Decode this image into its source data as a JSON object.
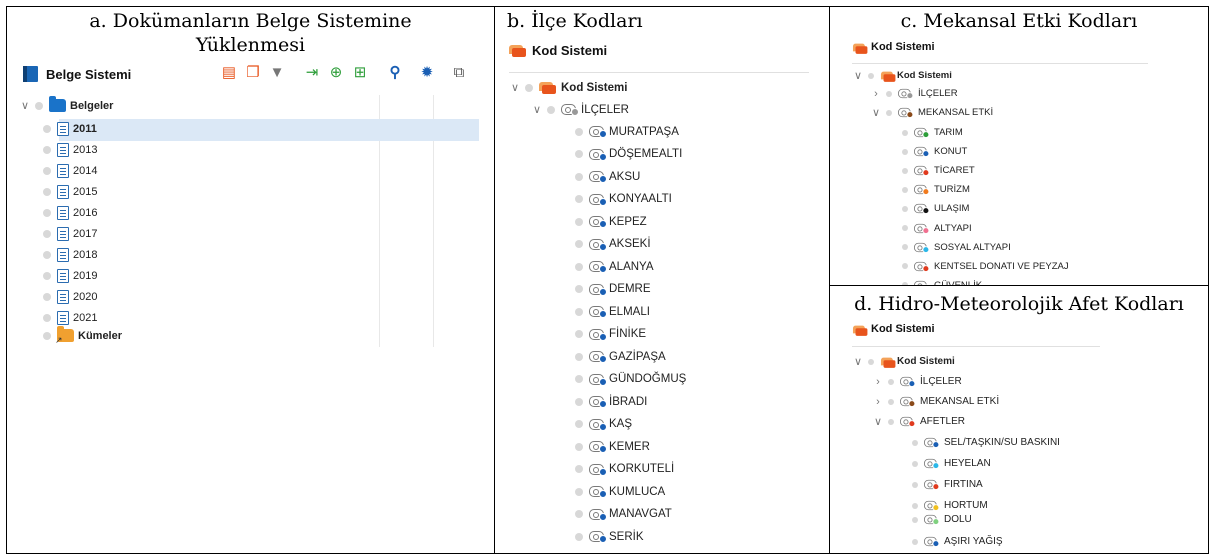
{
  "panel_a": {
    "title_line1": "a. Dokümanların Belge Sistemine",
    "title_line2": "Yüklenmesi",
    "header": "Belge Sistemi",
    "toolbar_icons": [
      "clipboard-icon",
      "copy-icon",
      "filter-icon",
      "import-icon",
      "add-document-icon",
      "add-folder-icon",
      "search-icon",
      "gear-icon",
      "window-icon"
    ],
    "tree": {
      "root_label": "Belgeler",
      "years": [
        "2011",
        "2013",
        "2014",
        "2015",
        "2016",
        "2017",
        "2018",
        "2019",
        "2020",
        "2021"
      ],
      "selected": "2011",
      "clusters_label": "Kümeler"
    }
  },
  "panel_b": {
    "title": "b. İlçe Kodları",
    "header": "Kod Sistemi",
    "root_label": "Kod Sistemi",
    "group_label": "İLÇELER",
    "dot_color": "#1a5fb4",
    "districts": [
      "MURATPAŞA",
      "DÖŞEMEALTI",
      "AKSU",
      "KONYAALTI",
      "KEPEZ",
      "AKSEKİ",
      "ALANYA",
      "DEMRE",
      "ELMALI",
      "FİNİKE",
      "GAZİPAŞA",
      "GÜNDOĞMUŞ",
      "İBRADI",
      "KAŞ",
      "KEMER",
      "KORKUTELİ",
      "KUMLUCA",
      "MANAVGAT",
      "SERİK"
    ]
  },
  "panel_c": {
    "title": "c. Mekansal Etki Kodları",
    "header": "Kod Sistemi",
    "root_label": "Kod Sistemi",
    "group1_label": "İLÇELER",
    "group2_label": "MEKANSAL ETKİ",
    "codes": [
      {
        "label": "TARIM",
        "color": "#2e9e3a"
      },
      {
        "label": "KONUT",
        "color": "#1a5fb4"
      },
      {
        "label": "TİCARET",
        "color": "#e03a1e"
      },
      {
        "label": "TURİZM",
        "color": "#f07a1e"
      },
      {
        "label": "ULAŞIM",
        "color": "#111111"
      },
      {
        "label": "ALTYAPI",
        "color": "#f07090"
      },
      {
        "label": "SOSYAL ALTYAPI",
        "color": "#2bb7e8"
      },
      {
        "label": "KENTSEL DONATI VE PEYZAJ",
        "color": "#e03a1e"
      },
      {
        "label": "GÜVENLİK",
        "color": "#e84a1e"
      }
    ]
  },
  "panel_d": {
    "title": "d. Hidro-Meteorolojik Afet Kodları",
    "header": "Kod Sistemi",
    "root_label": "Kod Sistemi",
    "group1_label": "İLÇELER",
    "group2_label": "MEKANSAL ETKİ",
    "group3_label": "AFETLER",
    "codes": [
      {
        "label": "SEL/TAŞKIN/SU BASKINI",
        "color": "#1a5fb4"
      },
      {
        "label": "HEYELAN",
        "color": "#2bb7e8"
      },
      {
        "label": "FIRTINA",
        "color": "#e03a1e"
      },
      {
        "label": "HORTUM",
        "color": "#f0c020"
      },
      {
        "label": "DOLU",
        "color": "#7fd07f"
      },
      {
        "label": "AŞIRI YAĞIŞ",
        "color": "#1a5fb4"
      }
    ]
  }
}
